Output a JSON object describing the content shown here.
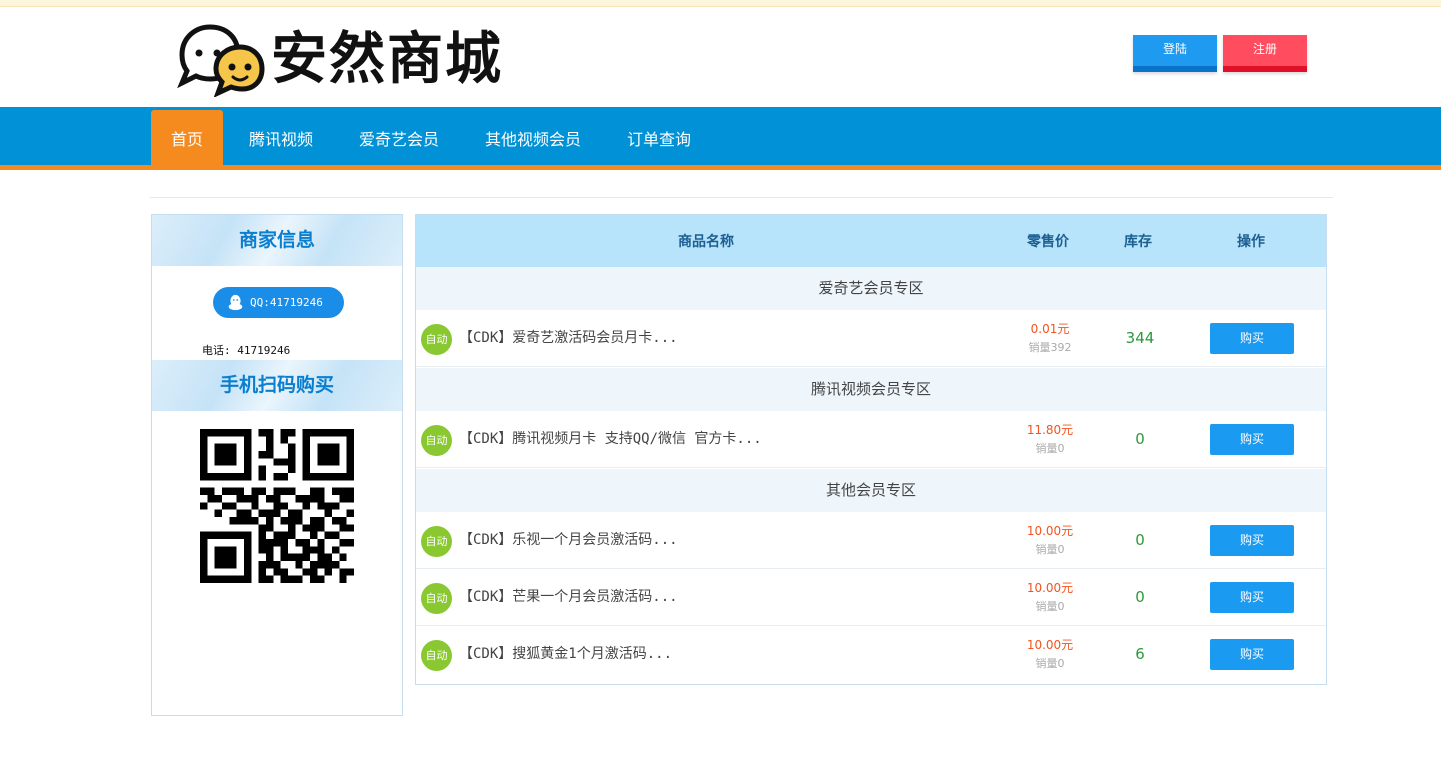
{
  "header": {
    "logo_text": "安然商城",
    "login_label": "登陆",
    "register_label": "注册"
  },
  "nav": {
    "items": [
      "首页",
      "腾讯视频",
      "爱奇艺会员",
      "其他视频会员",
      "订单查询"
    ]
  },
  "sidebar": {
    "merchant_title": "商家信息",
    "qq_label": "QQ:41719246",
    "phone_label": "电话: 41719246",
    "qr_title": "手机扫码购买"
  },
  "table": {
    "headers": {
      "name": "商品名称",
      "price": "零售价",
      "stock": "库存",
      "action": "操作"
    },
    "sections": [
      {
        "title": "爱奇艺会员专区",
        "products": [
          {
            "badge": "自动",
            "name": "【CDK】爱奇艺激活码会员月卡...",
            "price": "0.01元",
            "sales": "销量392",
            "stock": "344",
            "buy": "购买"
          }
        ]
      },
      {
        "title": "腾讯视频会员专区",
        "products": [
          {
            "badge": "自动",
            "name": "【CDK】腾讯视频月卡 支持QQ/微信 官方卡...",
            "price": "11.80元",
            "sales": "销量0",
            "stock": "0",
            "buy": "购买"
          }
        ]
      },
      {
        "title": "其他会员专区",
        "products": [
          {
            "badge": "自动",
            "name": "【CDK】乐视一个月会员激活码...",
            "price": "10.00元",
            "sales": "销量0",
            "stock": "0",
            "buy": "购买"
          },
          {
            "badge": "自动",
            "name": "【CDK】芒果一个月会员激活码...",
            "price": "10.00元",
            "sales": "销量0",
            "stock": "0",
            "buy": "购买"
          },
          {
            "badge": "自动",
            "name": "【CDK】搜狐黄金1个月激活码...",
            "price": "10.00元",
            "sales": "销量0",
            "stock": "6",
            "buy": "购买"
          }
        ]
      }
    ]
  },
  "colors": {
    "nav_blue": "#0191d6",
    "nav_active_orange": "#f58b1f",
    "login_blue": "#1e9bf0",
    "register_red": "#ff4c5f",
    "price_orange": "#f2531f",
    "stock_green": "#2b9a3a",
    "auto_badge_green": "#8ac832"
  },
  "icons": {
    "logo": "chat-bubbles-logo-icon",
    "qq": "qq-penguin-icon",
    "qr": "qr-code-icon"
  }
}
